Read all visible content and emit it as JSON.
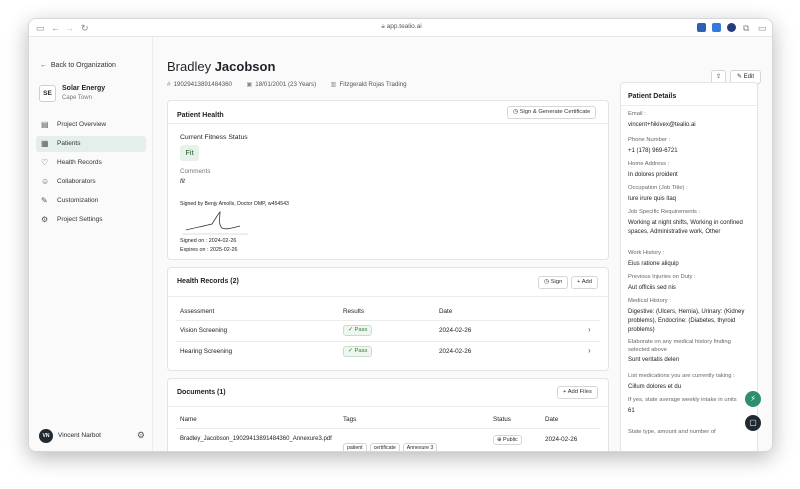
{
  "browser": {
    "url": "app.tealio.ai"
  },
  "sidebar": {
    "back_label": "Back to Organization",
    "org": {
      "initials": "SE",
      "name": "Solar Energy",
      "city": "Cape Town"
    },
    "items": [
      {
        "label": "Project Overview",
        "icon": "overview-icon"
      },
      {
        "label": "Patients",
        "icon": "patients-icon",
        "active": true
      },
      {
        "label": "Health Records",
        "icon": "heart-icon"
      },
      {
        "label": "Collaborators",
        "icon": "users-icon"
      },
      {
        "label": "Customization",
        "icon": "brush-icon"
      },
      {
        "label": "Project Settings",
        "icon": "gear-icon"
      }
    ],
    "user": {
      "initials": "VN",
      "name": "Vincent Narbot"
    }
  },
  "patient": {
    "first_name": "Bradley",
    "last_name": "Jacobson",
    "id_number": "19029413891484360",
    "dob": "18/01/2001 (23 Years)",
    "employer": "Fitzgerald Rojas Trading",
    "edit_label": "Edit"
  },
  "health": {
    "title": "Patient Health",
    "sign_btn": "Sign & Generate Certificate",
    "status_label": "Current Fitness Status",
    "status_value": "Fit",
    "comments_label": "Comments",
    "comments_value": "fit",
    "signed_by": "Signed by Benjy Amolls, Doctor OMP, w454543",
    "signed_on": "Signed on : 2024-02-26",
    "expires_on": "Expires on : 2025-02-26"
  },
  "records": {
    "title": "Health Records (2)",
    "sign_label": "Sign",
    "add_label": "Add",
    "columns": [
      "Assessment",
      "Results",
      "Date"
    ],
    "rows": [
      {
        "assessment": "Vision Screening",
        "result": "Pass",
        "date": "2024-02-26"
      },
      {
        "assessment": "Hearing Screening",
        "result": "Pass",
        "date": "2024-02-26"
      }
    ]
  },
  "documents": {
    "title": "Documents (1)",
    "add_label": "Add Files",
    "columns": [
      "Name",
      "Tags",
      "Status",
      "Date"
    ],
    "rows": [
      {
        "name": "Bradley_Jacobson_19029413891484360_Annexure3.pdf",
        "tags": [
          "patient",
          "certificate",
          "Annexure 3"
        ],
        "status": "Public",
        "date": "2024-02-26"
      }
    ]
  },
  "details": {
    "title": "Patient Details",
    "fields": [
      {
        "k": "Email :",
        "v": "vincent+hikivex@tealio.ai"
      },
      {
        "k": "Phone Number :",
        "v": "+1 (178) 969-6721"
      },
      {
        "k": "Home Address :",
        "v": "In dolores proident"
      },
      {
        "k": "Occupation (Job Title) :",
        "v": "Iure irure quis itaq"
      },
      {
        "k": "Job Specific Requirements :",
        "v": "Working at night shifts, Working in confined spaces, Administrative work, Other"
      },
      {
        "k": "Work History :",
        "v": "Eius ratione aliquip"
      },
      {
        "k": "Previous Injuries on Duty :",
        "v": "Aut officiis sed nis"
      },
      {
        "k": "Medical History :",
        "v": "Digestive: (Ulcers, Hernia), Urinary: (Kidney problems), Endocrine: (Diabetes, thyroid problems)"
      },
      {
        "k": "Elaborate on any medical history finding selected above",
        "v": "Sunt veritatis delen"
      },
      {
        "k": "List medications you are currently taking :",
        "v": "Cillum dolores et du"
      },
      {
        "k": "If yes, state average weekly intake in units",
        "v": "61"
      },
      {
        "k": "State type, amount and number of",
        "v": ""
      }
    ]
  }
}
